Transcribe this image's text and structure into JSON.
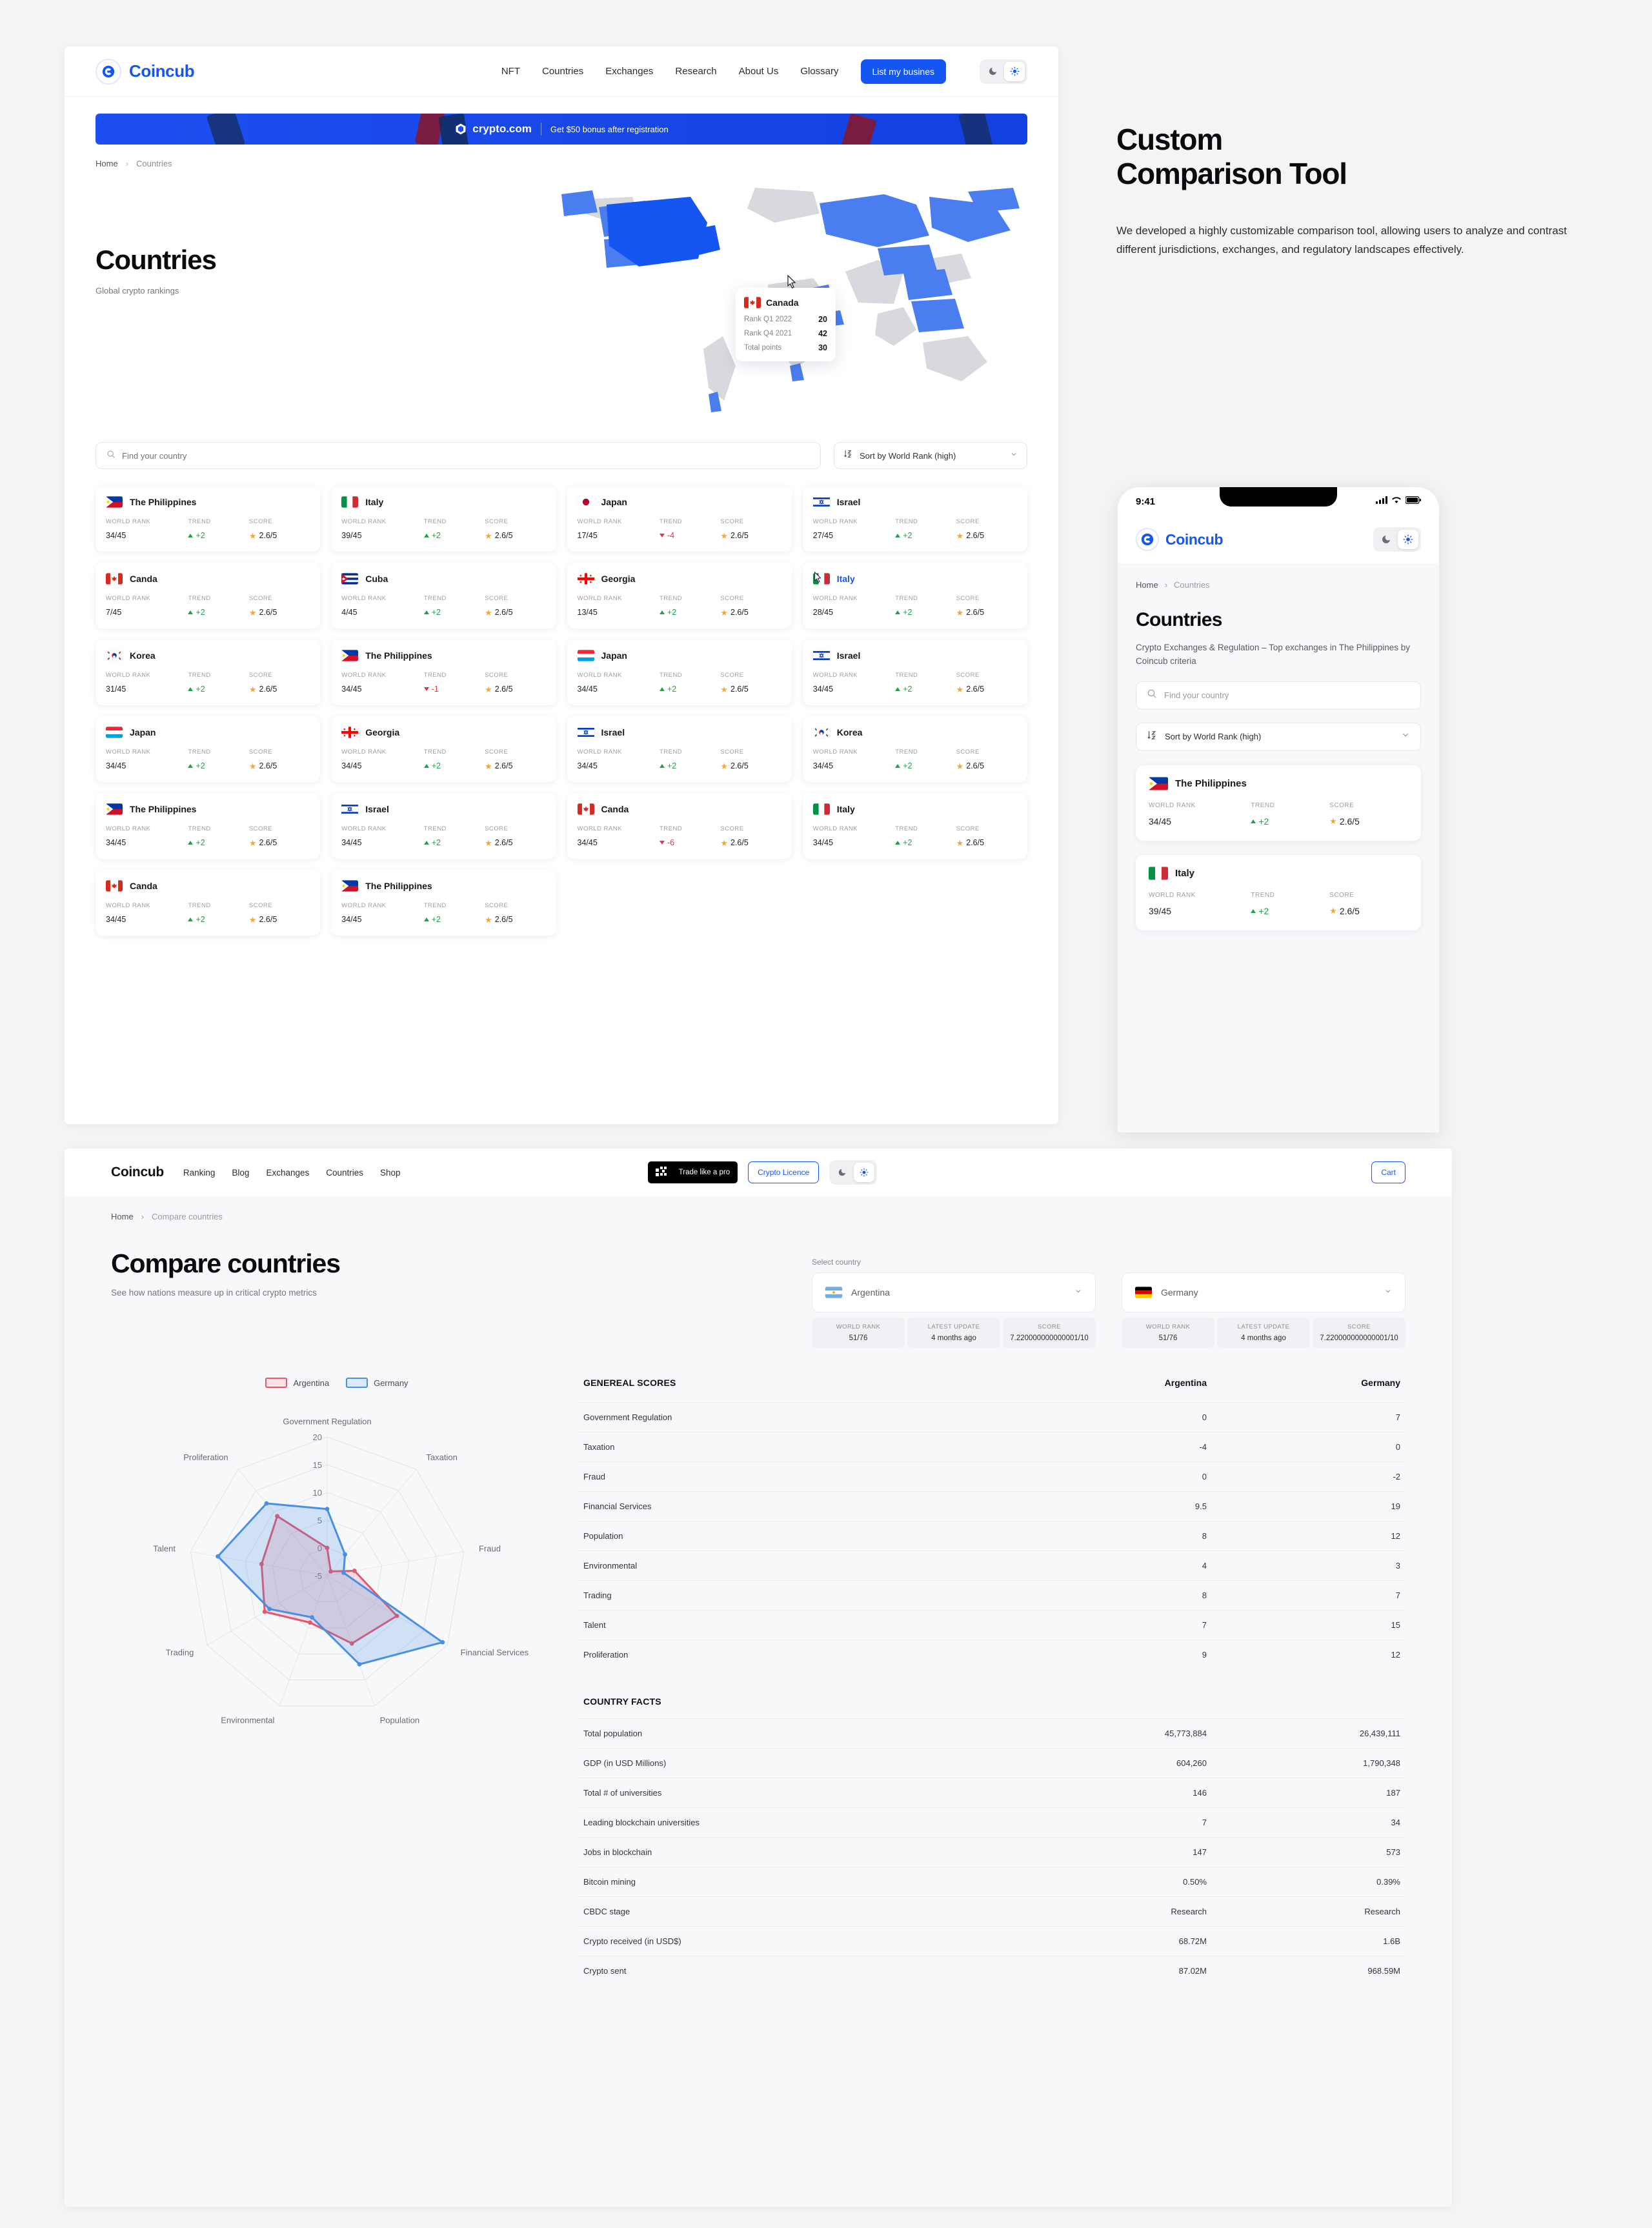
{
  "brand": {
    "name": "Coincub",
    "accent": "#1556f0"
  },
  "topnav": {
    "links": [
      "NFT",
      "Countries",
      "Exchanges",
      "Research",
      "About Us",
      "Glossary"
    ],
    "cta": "List my busines",
    "theme": {
      "dark_icon": "moon-icon",
      "light_icon": "sun-icon",
      "active": "light"
    }
  },
  "promo": {
    "brand": "crypto.com",
    "text": "Get $50 bonus after registration"
  },
  "breadcrumb": {
    "home": "Home",
    "sep": "›",
    "current": "Countries"
  },
  "hero": {
    "title": "Countries",
    "subtitle": "Global crypto rankings"
  },
  "tooltip": {
    "country": "Canada",
    "rows": [
      {
        "label": "Rank Q1 2022",
        "value": "20"
      },
      {
        "label": "Rank Q4 2021",
        "value": "42"
      },
      {
        "label": "Total points",
        "value": "30"
      }
    ]
  },
  "filters": {
    "search_placeholder": "Find your country",
    "search_value": "",
    "sort_label": "Sort by World Rank (high)",
    "sort_icon": "sort-az-icon",
    "chevron": "chevron-down-icon"
  },
  "card_labels": {
    "rank": "WORLD RANK",
    "trend": "TREND",
    "score": "SCORE"
  },
  "countries": [
    {
      "name": "The Philippines",
      "flag": "ph",
      "rank": "34/45",
      "trend": "+2",
      "dir": "up",
      "score": "2.6/5"
    },
    {
      "name": "Italy",
      "flag": "it",
      "rank": "39/45",
      "trend": "+2",
      "dir": "up",
      "score": "2.6/5"
    },
    {
      "name": "Japan",
      "flag": "jp",
      "rank": "17/45",
      "trend": "-4",
      "dir": "down",
      "score": "2.6/5"
    },
    {
      "name": "Israel",
      "flag": "il",
      "rank": "27/45",
      "trend": "+2",
      "dir": "up",
      "score": "2.6/5"
    },
    {
      "name": "Canda",
      "flag": "ca",
      "rank": "7/45",
      "trend": "+2",
      "dir": "up",
      "score": "2.6/5"
    },
    {
      "name": "Cuba",
      "flag": "cu",
      "rank": "4/45",
      "trend": "+2",
      "dir": "up",
      "score": "2.6/5"
    },
    {
      "name": "Georgia",
      "flag": "ge",
      "rank": "13/45",
      "trend": "+2",
      "dir": "up",
      "score": "2.6/5"
    },
    {
      "name": "Italy",
      "flag": "it",
      "rank": "28/45",
      "trend": "+2",
      "dir": "up",
      "score": "2.6/5",
      "hover": true
    },
    {
      "name": "Korea",
      "flag": "kr",
      "rank": "31/45",
      "trend": "+2",
      "dir": "up",
      "score": "2.6/5"
    },
    {
      "name": "The Philippines",
      "flag": "ph",
      "rank": "34/45",
      "trend": "-1",
      "dir": "down",
      "score": "2.6/5"
    },
    {
      "name": "Japan",
      "flag": "lu",
      "rank": "34/45",
      "trend": "+2",
      "dir": "up",
      "score": "2.6/5"
    },
    {
      "name": "Israel",
      "flag": "il",
      "rank": "34/45",
      "trend": "+2",
      "dir": "up",
      "score": "2.6/5"
    },
    {
      "name": "Japan",
      "flag": "lu",
      "rank": "34/45",
      "trend": "+2",
      "dir": "up",
      "score": "2.6/5"
    },
    {
      "name": "Georgia",
      "flag": "ge",
      "rank": "34/45",
      "trend": "+2",
      "dir": "up",
      "score": "2.6/5"
    },
    {
      "name": "Israel",
      "flag": "il",
      "rank": "34/45",
      "trend": "+2",
      "dir": "up",
      "score": "2.6/5"
    },
    {
      "name": "Korea",
      "flag": "kr",
      "rank": "34/45",
      "trend": "+2",
      "dir": "up",
      "score": "2.6/5"
    },
    {
      "name": "The Philippines",
      "flag": "ph",
      "rank": "34/45",
      "trend": "+2",
      "dir": "up",
      "score": "2.6/5"
    },
    {
      "name": "Israel",
      "flag": "il",
      "rank": "34/45",
      "trend": "+2",
      "dir": "up",
      "score": "2.6/5"
    },
    {
      "name": "Canda",
      "flag": "ca",
      "rank": "34/45",
      "trend": "-6",
      "dir": "down",
      "score": "2.6/5"
    },
    {
      "name": "Italy",
      "flag": "it",
      "rank": "34/45",
      "trend": "+2",
      "dir": "up",
      "score": "2.6/5"
    },
    {
      "name": "Canda",
      "flag": "ca",
      "rank": "34/45",
      "trend": "+2",
      "dir": "up",
      "score": "2.6/5"
    },
    {
      "name": "The Philippines",
      "flag": "ph",
      "rank": "34/45",
      "trend": "+2",
      "dir": "up",
      "score": "2.6/5"
    }
  ],
  "right_panel": {
    "title_line1": "Custom",
    "title_line2": "Comparison Tool",
    "body": "We developed a highly customizable comparison tool, allowing users to analyze and contrast different jurisdictions, exchanges, and regulatory landscapes effectively."
  },
  "phone": {
    "time": "9:41",
    "status_icons": [
      "cellular-icon",
      "wifi-icon",
      "battery-icon"
    ],
    "crumb_home": "Home",
    "crumb_current": "Countries",
    "title": "Countries",
    "subtitle": "Crypto Exchanges & Regulation – Top exchanges in The Philippines by Coincub criteria",
    "search_placeholder": "Find your country",
    "sort_label": "Sort by World Rank (high)",
    "cards": [
      {
        "name": "The Philippines",
        "flag": "ph",
        "rank": "34/45",
        "trend": "+2",
        "dir": "up",
        "score": "2.6/5"
      },
      {
        "name": "Italy",
        "flag": "it",
        "rank": "39/45",
        "trend": "+2",
        "dir": "up",
        "score": "2.6/5"
      }
    ]
  },
  "bottom": {
    "logo": "Coincub",
    "links": [
      "Ranking",
      "Blog",
      "Exchanges",
      "Countries",
      "Shop"
    ],
    "okx_brand": "OKX",
    "okx_text": "Trade like a pro",
    "licence_btn": "Crypto Licence",
    "cart_btn": "Cart",
    "crumb_home": "Home",
    "crumb_current": "Compare countries",
    "title": "Compare countries",
    "subtitle": "See how nations measure up in critical crypto metrics",
    "select_label": "Select country",
    "selects": [
      {
        "country": "Argentina",
        "flag": "ar",
        "stats": [
          {
            "k": "WORLD RANK",
            "v": "51/76"
          },
          {
            "k": "LATEST UPDATE",
            "v": "4 months ago"
          },
          {
            "k": "SCORE",
            "v": "7.220000000000001/10"
          }
        ]
      },
      {
        "country": "Germany",
        "flag": "de",
        "stats": [
          {
            "k": "WORLD RANK",
            "v": "51/76"
          },
          {
            "k": "LATEST UPDATE",
            "v": "4 months ago"
          },
          {
            "k": "SCORE",
            "v": "7.220000000000001/10"
          }
        ]
      }
    ],
    "scores_title": "GENEREAL SCORES",
    "col_a": "Argentina",
    "col_b": "Germany",
    "facts_title": "COUNTRY FACTS",
    "facts": [
      {
        "label": "Total population",
        "a": "45,773,884",
        "b": "26,439,111"
      },
      {
        "label": "GDP (in USD Millions)",
        "a": "604,260",
        "b": "1,790,348"
      },
      {
        "label": "Total # of universities",
        "a": "146",
        "b": "187"
      },
      {
        "label": "Leading blockchain universities",
        "a": "7",
        "b": "34"
      },
      {
        "label": "Jobs in blockchain",
        "a": "147",
        "b": "573"
      },
      {
        "label": "Bitcoin mining",
        "a": "0.50%",
        "b": "0.39%"
      },
      {
        "label": "CBDC stage",
        "a": "Research",
        "b": "Research"
      },
      {
        "label": "Crypto received (in USD$)",
        "a": "68.72M",
        "b": "1.6B"
      },
      {
        "label": "Crypto sent",
        "a": "87.02M",
        "b": "968.59M"
      }
    ]
  },
  "chart_data": {
    "type": "radar",
    "title": "",
    "legend": [
      "Argentina",
      "Germany"
    ],
    "legend_position": "top",
    "colors": {
      "Argentina": "#e4556e",
      "Germany": "#4a90e2"
    },
    "categories": [
      "Government Regulation",
      "Taxation",
      "Fraud",
      "Financial Services",
      "Population",
      "Environmental",
      "Trading",
      "Talent",
      "Proliferation"
    ],
    "ticks": [
      -5,
      0,
      5,
      10,
      15,
      20
    ],
    "rlim": [
      -5,
      20
    ],
    "grid": true,
    "series": [
      {
        "name": "Argentina",
        "values": [
          0,
          -4,
          0,
          9.5,
          8,
          4,
          8,
          7,
          9
        ]
      },
      {
        "name": "Germany",
        "values": [
          7,
          0,
          -2,
          19,
          12,
          3,
          7,
          15,
          12
        ]
      }
    ]
  }
}
